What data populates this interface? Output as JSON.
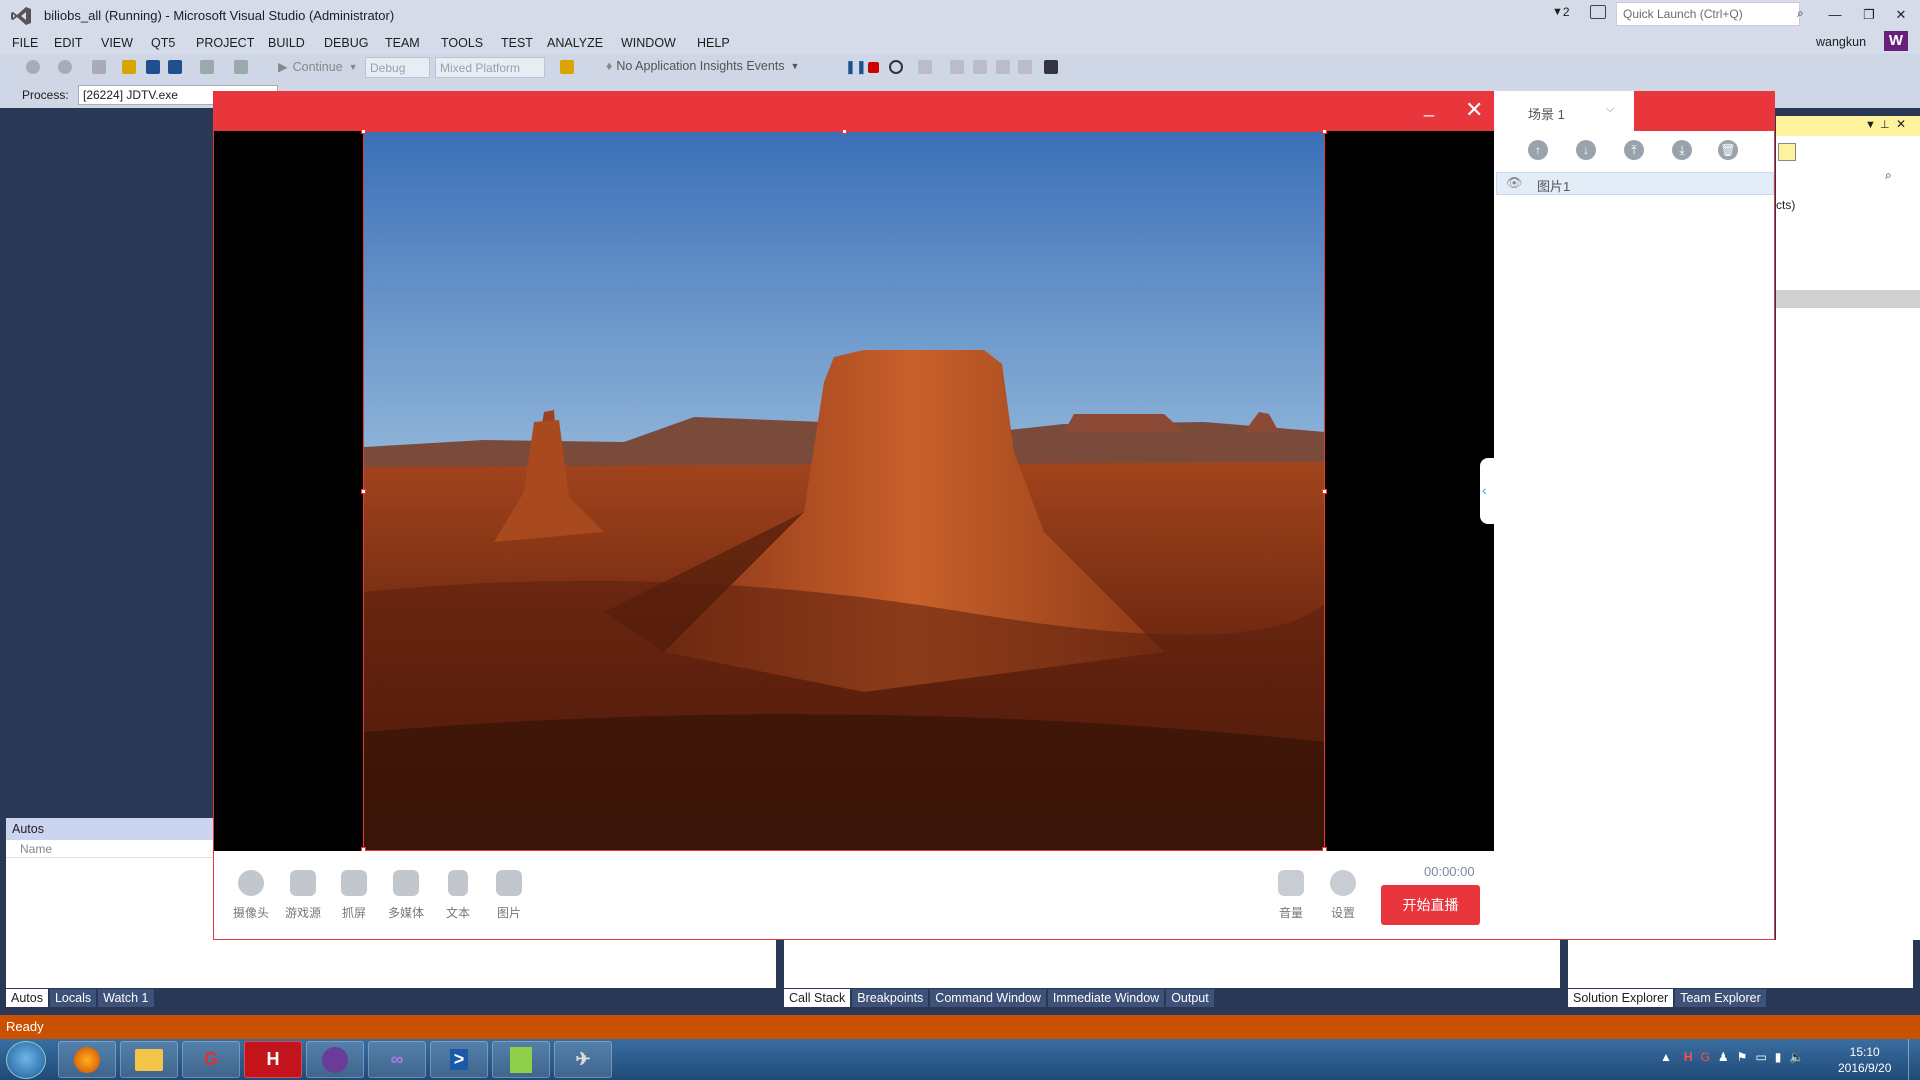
{
  "vs": {
    "title": "biliobs_all (Running) - Microsoft Visual Studio (Administrator)",
    "notifications": "2",
    "quick_launch_placeholder": "Quick Launch (Ctrl+Q)",
    "menu": [
      "FILE",
      "EDIT",
      "VIEW",
      "QT5",
      "PROJECT",
      "BUILD",
      "DEBUG",
      "TEAM",
      "TOOLS",
      "TEST",
      "ANALYZE",
      "WINDOW",
      "HELP"
    ],
    "user": "wangkun",
    "user_initial": "W",
    "toolbar": {
      "continue_label": "Continue",
      "config": "Debug",
      "platform": "Mixed Platform",
      "insights": "No Application Insights Events"
    },
    "process_label": "Process:",
    "process_value": "[26224] JDTV.exe",
    "autos_title": "Autos",
    "autos_column": "Name",
    "bottom_left_tabs": [
      "Autos",
      "Locals",
      "Watch 1"
    ],
    "bottom_mid_tabs": [
      "Call Stack",
      "Breakpoints",
      "Command Window",
      "Immediate Window",
      "Output"
    ],
    "bottom_right_tabs": [
      "Solution Explorer",
      "Team Explorer"
    ],
    "sol_partial_text": "cts)",
    "status": "Ready"
  },
  "app": {
    "scene_name": "场景 1",
    "scene_item": "图片1",
    "timer": "00:00:00",
    "start_live": "开始直播",
    "sources": [
      {
        "label": "摄像头",
        "icon": "camera-icon"
      },
      {
        "label": "游戏源",
        "icon": "gamepad-icon"
      },
      {
        "label": "抓屏",
        "icon": "screen-capture-icon"
      },
      {
        "label": "多媒体",
        "icon": "media-icon"
      },
      {
        "label": "文本",
        "icon": "text-icon"
      },
      {
        "label": "图片",
        "icon": "image-icon"
      }
    ],
    "controls": [
      {
        "label": "音量",
        "icon": "volume-icon"
      },
      {
        "label": "设置",
        "icon": "settings-icon"
      }
    ]
  },
  "taskbar": {
    "clock_time": "15:10",
    "clock_date": "2016/9/20"
  },
  "colors": {
    "brand_red": "#e8363c",
    "vs_chrome": "#d6dbe9",
    "status_orange": "#ca5100"
  }
}
